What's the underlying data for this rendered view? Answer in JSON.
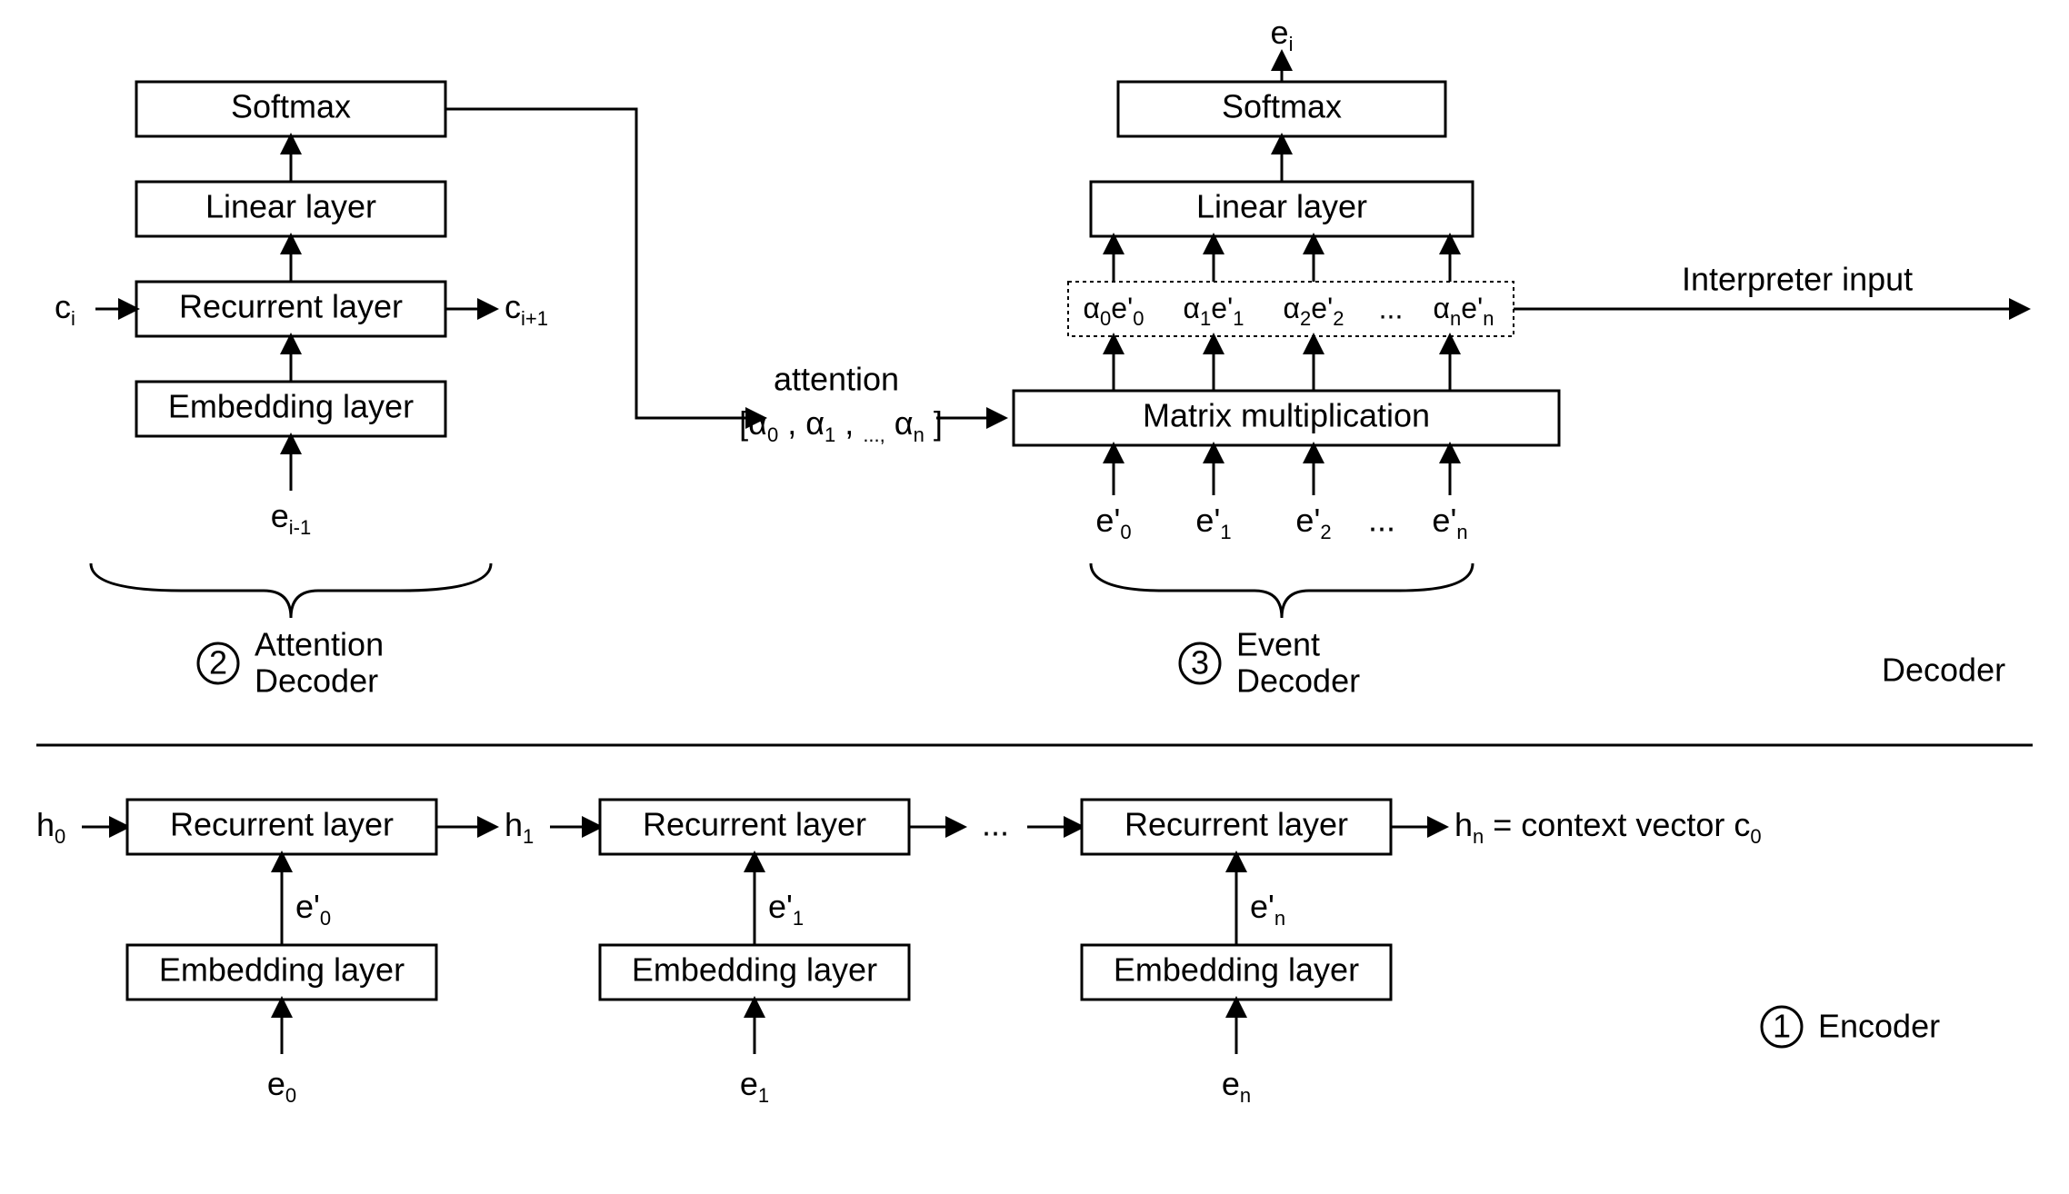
{
  "decoder": {
    "attention": {
      "softmax": "Softmax",
      "linear": "Linear layer",
      "recurrent": "Recurrent layer",
      "embedding": "Embedding layer",
      "c_in": "c",
      "c_in_sub": "i",
      "c_out": "c",
      "c_out_sub": "i+1",
      "e_prev": "e",
      "e_prev_sub": "i-1",
      "label_top": "Attention",
      "label_bot": "Decoder",
      "num": "2"
    },
    "middle": {
      "attn_word": "attention",
      "attn_vec_a": "[α",
      "attn_vec_b": ", α",
      "attn_vec_c": ", α",
      "attn_vec_end": "]",
      "dots": "...,",
      "s0": "0",
      "s1": "1",
      "sn": "n"
    },
    "event": {
      "softmax": "Softmax",
      "linear": "Linear layer",
      "matmul": "Matrix multiplication",
      "e_out": "e",
      "e_out_sub": "i",
      "alpha_e0": "α e'",
      "alpha_e0_a": "0",
      "alpha_e0_b": "0",
      "alpha_e0_c": "0",
      "ae0_a": "α",
      "ae0_b": "e'",
      "items": [
        {
          "a": "α",
          "as": "0",
          "e": "e'",
          "es": "0"
        },
        {
          "a": "α",
          "as": "1",
          "e": "e'",
          "es": "1"
        },
        {
          "a": "α",
          "as": "2",
          "e": "e'",
          "es": "2"
        },
        {
          "a": "",
          "as": "",
          "e": "...",
          "es": ""
        },
        {
          "a": "α",
          "as": "n",
          "e": "e'",
          "es": "n"
        }
      ],
      "inputs": [
        {
          "e": "e'",
          "s": "0"
        },
        {
          "e": "e'",
          "s": "1"
        },
        {
          "e": "e'",
          "s": "2"
        },
        {
          "e": "...",
          "s": ""
        },
        {
          "e": "e'",
          "s": "n"
        }
      ],
      "label_top": "Event",
      "label_bot": "Decoder",
      "num": "3",
      "interp": "Interpreter input"
    },
    "section": "Decoder"
  },
  "encoder": {
    "h0": "h",
    "h0s": "0",
    "h1": "h",
    "h1s": "1",
    "dots": "...",
    "hn_eq": "h  = context vector c",
    "hn_s": "n",
    "c0_s": "0",
    "recurrent": "Recurrent layer",
    "embedding": "Embedding layer",
    "e": "e",
    "ep": "e'",
    "s0": "0",
    "s1": "1",
    "sn": "n",
    "label": "Encoder",
    "num": "1"
  }
}
